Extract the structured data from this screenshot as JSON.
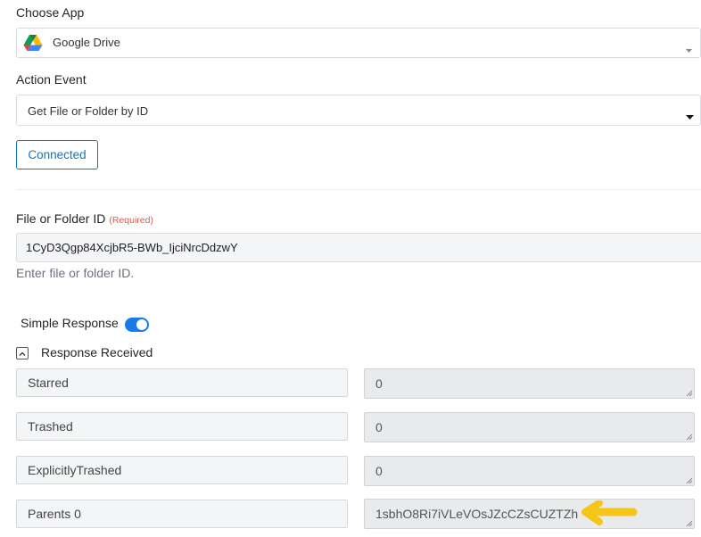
{
  "choose_app": {
    "label": "Choose App",
    "selected": "Google Drive",
    "icon": "google-drive-icon"
  },
  "action_event": {
    "label": "Action Event",
    "selected": "Get File or Folder by ID"
  },
  "connected_label": "Connected",
  "file_id": {
    "label": "File or Folder ID",
    "required": "(Required)",
    "value": "1CyD3Qgp84XcjbR5-BWb_IjciNrcDdzwY",
    "hint": "Enter file or folder ID."
  },
  "simple_response": {
    "label": "Simple Response",
    "enabled": true
  },
  "response_received": {
    "label": "Response Received",
    "rows": [
      {
        "key": "Starred",
        "value": "0"
      },
      {
        "key": "Trashed",
        "value": "0"
      },
      {
        "key": "ExplicitlyTrashed",
        "value": "0"
      },
      {
        "key": "Parents 0",
        "value": "1sbhO8Ri7iVLeVOsJZcCZsCUZTZh"
      }
    ]
  },
  "colors": {
    "accent": "#1a73b8",
    "toggle": "#1a7ae8",
    "required": "#e05a4a",
    "arrow": "#f5c518"
  }
}
